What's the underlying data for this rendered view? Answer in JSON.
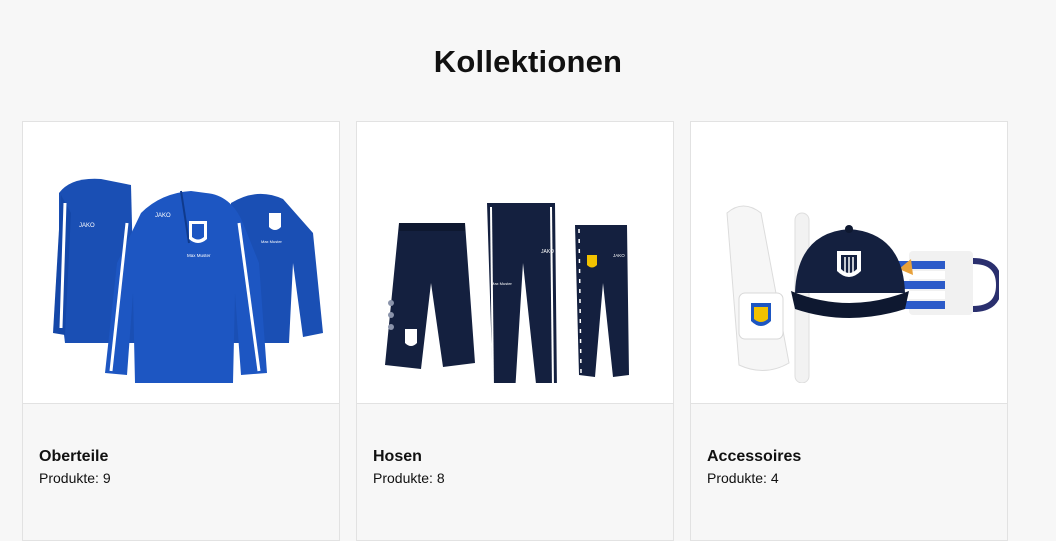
{
  "page": {
    "title": "Kollektionen"
  },
  "collections": [
    {
      "title": "Oberteile",
      "count_label": "Produkte: 9",
      "image_icon": "jackets-image",
      "brand_text": "JAKO",
      "crest_text": "Max Muster"
    },
    {
      "title": "Hosen",
      "count_label": "Produkte: 8",
      "image_icon": "pants-image",
      "brand_text": "JAKO",
      "crest_text": "Max Muster"
    },
    {
      "title": "Accessoires",
      "count_label": "Produkte: 4",
      "image_icon": "accessories-image"
    }
  ],
  "colors": {
    "royal_blue": "#1a4fb4",
    "navy": "#14203f",
    "background": "#f7f7f7",
    "card_image_bg": "#ffffff",
    "border": "#e2e2e2"
  }
}
